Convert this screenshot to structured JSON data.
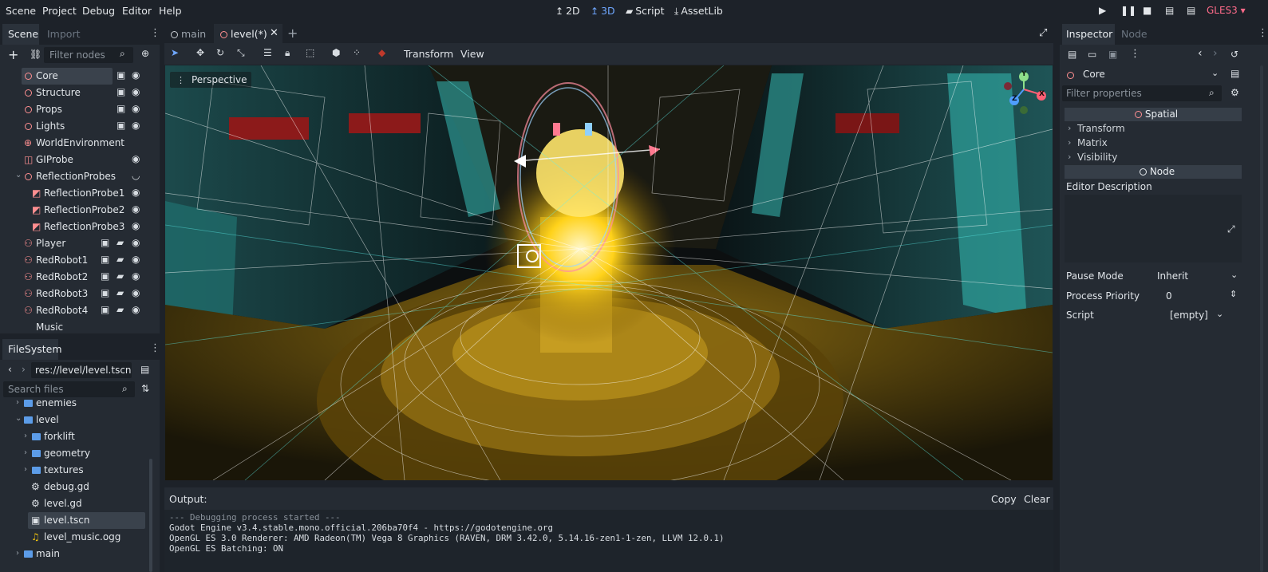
{
  "menu": [
    "Scene",
    "Project",
    "Debug",
    "Editor",
    "Help"
  ],
  "workspaces": [
    {
      "label": "2D",
      "icon": "2d-icon"
    },
    {
      "label": "3D",
      "icon": "3d-icon",
      "active": true
    },
    {
      "label": "Script",
      "icon": "script-icon"
    },
    {
      "label": "AssetLib",
      "icon": "assetlib-icon"
    }
  ],
  "renderer": "GLES3",
  "scene_dock": {
    "tabs": [
      "Scene",
      "Import"
    ],
    "filter_placeholder": "Filter nodes",
    "nodes": [
      {
        "label": "Core",
        "selected": true
      },
      {
        "label": "Structure"
      },
      {
        "label": "Props"
      },
      {
        "label": "Lights"
      },
      {
        "label": "WorldEnvironment"
      },
      {
        "label": "GIProbe"
      },
      {
        "label": "ReflectionProbes"
      },
      {
        "label": "ReflectionProbe1"
      },
      {
        "label": "ReflectionProbe2"
      },
      {
        "label": "ReflectionProbe3"
      },
      {
        "label": "Player"
      },
      {
        "label": "RedRobot1"
      },
      {
        "label": "RedRobot2"
      },
      {
        "label": "RedRobot3"
      },
      {
        "label": "RedRobot4"
      },
      {
        "label": "Music"
      }
    ]
  },
  "filesystem": {
    "title": "FileSystem",
    "path": "res://level/level.tscn",
    "search_placeholder": "Search files",
    "items": [
      {
        "label": "enemies",
        "type": "folder"
      },
      {
        "label": "level",
        "type": "folder"
      },
      {
        "label": "forklift",
        "type": "folder"
      },
      {
        "label": "geometry",
        "type": "folder"
      },
      {
        "label": "textures",
        "type": "folder"
      },
      {
        "label": "debug.gd",
        "type": "script"
      },
      {
        "label": "level.gd",
        "type": "script"
      },
      {
        "label": "level.tscn",
        "type": "scene",
        "selected": true
      },
      {
        "label": "level_music.ogg",
        "type": "audio"
      },
      {
        "label": "main",
        "type": "folder"
      }
    ]
  },
  "editor_tabs": [
    "main",
    "level(*)"
  ],
  "viewport_toolbar": {
    "transform": "Transform",
    "view": "View"
  },
  "viewport": {
    "perspective_label": "Perspective",
    "gizmo_axes": [
      "Y",
      "X",
      "Z"
    ]
  },
  "output": {
    "title": "Output:",
    "copy": "Copy",
    "clear": "Clear",
    "lines": [
      "--- Debugging process started ---",
      "Godot Engine v3.4.stable.mono.official.206ba70f4 - https://godotengine.org",
      "OpenGL ES 3.0 Renderer: AMD Radeon(TM) Vega 8 Graphics (RAVEN, DRM 3.42.0, 5.14.16-zen1-1-zen, LLVM 12.0.1)",
      "OpenGL ES Batching: ON"
    ]
  },
  "inspector": {
    "tabs": [
      "Inspector",
      "Node"
    ],
    "node_name": "Core",
    "filter_placeholder": "Filter properties",
    "sections": {
      "spatial": "Spatial",
      "transform": "Transform",
      "matrix": "Matrix",
      "visibility": "Visibility",
      "node": "Node",
      "editor_description": "Editor Description"
    },
    "properties": [
      {
        "label": "Pause Mode",
        "value": "Inherit"
      },
      {
        "label": "Process Priority",
        "value": "0"
      },
      {
        "label": "Script",
        "value": "[empty]"
      }
    ]
  },
  "colors": {
    "background": "#1d2229",
    "panel": "#252b33",
    "accent": "#6fa7ff",
    "node_icon": "#ff8f91",
    "renderer": "#ff6b8a"
  }
}
